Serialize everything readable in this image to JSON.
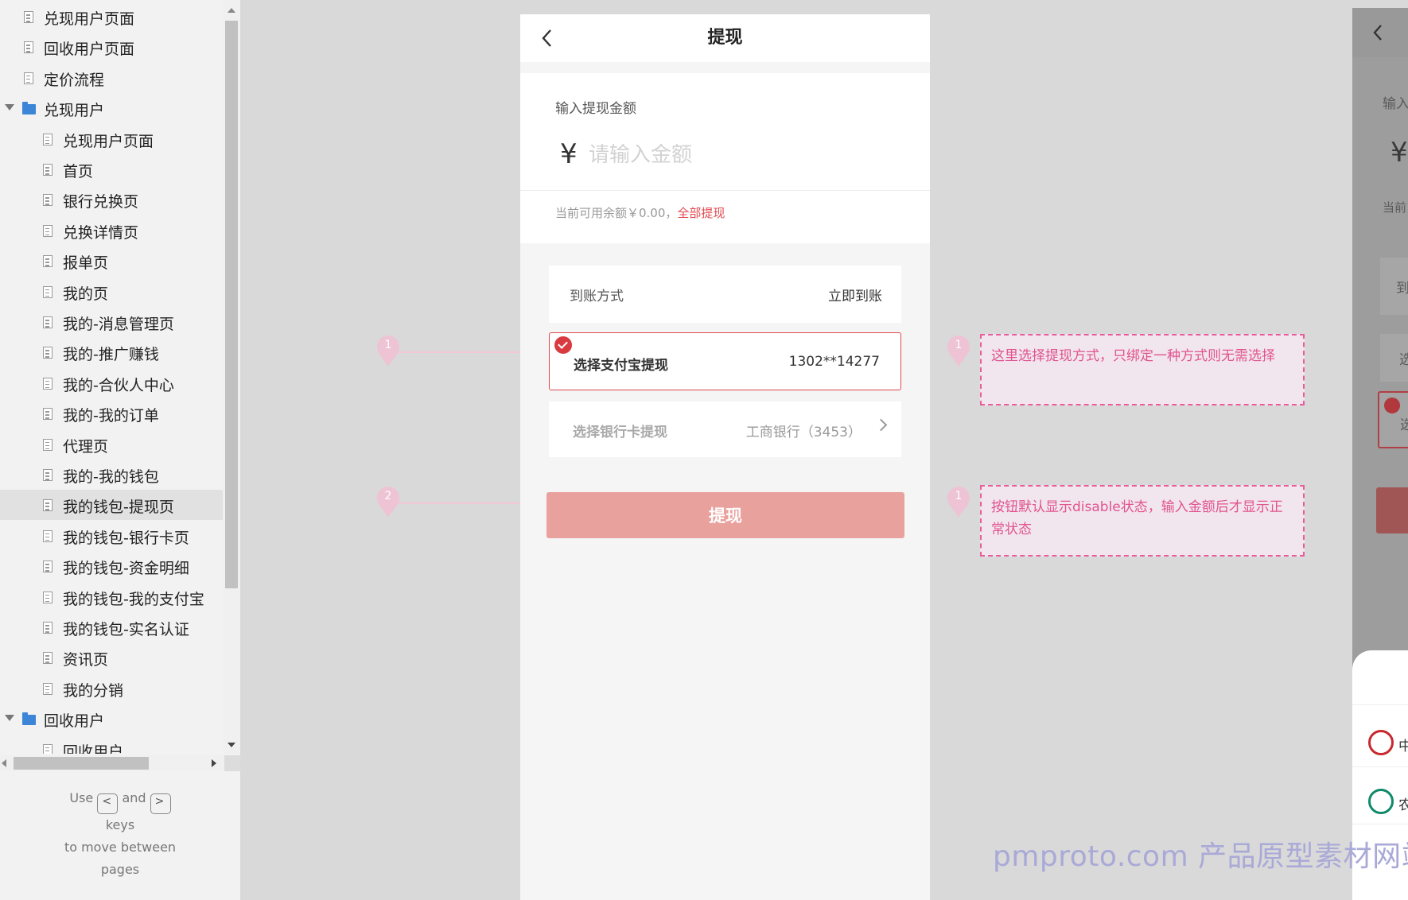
{
  "sidebar": {
    "items": [
      {
        "label": "兑现用户页面",
        "type": "page",
        "level": 0
      },
      {
        "label": "回收用户页面",
        "type": "page",
        "level": 0
      },
      {
        "label": "定价流程",
        "type": "page",
        "level": 0
      },
      {
        "label": "兑现用户",
        "type": "folder",
        "level": 0
      },
      {
        "label": "兑现用户页面",
        "type": "page",
        "level": 1
      },
      {
        "label": "首页",
        "type": "page",
        "level": 1
      },
      {
        "label": "银行兑换页",
        "type": "page",
        "level": 1
      },
      {
        "label": "兑换详情页",
        "type": "page",
        "level": 1
      },
      {
        "label": "报单页",
        "type": "page",
        "level": 1
      },
      {
        "label": "我的页",
        "type": "page",
        "level": 1
      },
      {
        "label": "我的-消息管理页",
        "type": "page",
        "level": 1
      },
      {
        "label": "我的-推广赚钱",
        "type": "page",
        "level": 1
      },
      {
        "label": "我的-合伙人中心",
        "type": "page",
        "level": 1
      },
      {
        "label": "我的-我的订单",
        "type": "page",
        "level": 1
      },
      {
        "label": "代理页",
        "type": "page",
        "level": 1
      },
      {
        "label": "我的-我的钱包",
        "type": "page",
        "level": 1
      },
      {
        "label": "我的钱包-提现页",
        "type": "page",
        "level": 1,
        "selected": true
      },
      {
        "label": "我的钱包-银行卡页",
        "type": "page",
        "level": 1
      },
      {
        "label": "我的钱包-资金明细",
        "type": "page",
        "level": 1
      },
      {
        "label": "我的钱包-我的支付宝",
        "type": "page",
        "level": 1
      },
      {
        "label": "我的钱包-实名认证",
        "type": "page",
        "level": 1
      },
      {
        "label": "资讯页",
        "type": "page",
        "level": 1
      },
      {
        "label": "我的分销",
        "type": "page",
        "level": 1
      },
      {
        "label": "回收用户",
        "type": "folder",
        "level": 0
      },
      {
        "label": "回收用户",
        "type": "page",
        "level": 1
      }
    ],
    "keys_help": {
      "use": "Use",
      "prev_key": "<",
      "and": "and",
      "next_key": ">",
      "keys": "keys",
      "line2": "to move between",
      "line3": "pages"
    }
  },
  "phone": {
    "title": "提现",
    "amount_label": "输入提现金额",
    "currency_symbol": "¥",
    "amount_placeholder": "请输入金额",
    "balance_text": "当前可用余额￥0.00，",
    "withdraw_all": "全部提现",
    "method_label": "到账方式",
    "method_value": "立即到账",
    "alipay_label": "选择支付宝提现",
    "alipay_account": "1302**14277",
    "bank_label": "选择银行卡提现",
    "bank_value": "工商银行（3453）",
    "submit_label": "提现"
  },
  "annotations": [
    {
      "marker": "1",
      "side": "left"
    },
    {
      "marker": "2",
      "side": "left"
    },
    {
      "marker": "1",
      "side": "right",
      "note": "这里选择提现方式，只绑定一种方式则无需选择"
    },
    {
      "marker": "1",
      "side": "right",
      "note": "按钮默认显示disable状态，输入金额后才显示正常状态"
    }
  ],
  "right_preview": {
    "t1": "输入",
    "yen": "¥",
    "t2": "当前",
    "t3": "到",
    "t4": "选",
    "t5": "选",
    "bank1": "中",
    "bank2": "农"
  },
  "watermark": "pmproto.com 产品原型素材网站",
  "colors": {
    "accent_red": "#e0484d",
    "button_disabled": "#e9a19d",
    "annotation_pink": "#e85e9a",
    "folder_blue": "#3d85d6"
  }
}
